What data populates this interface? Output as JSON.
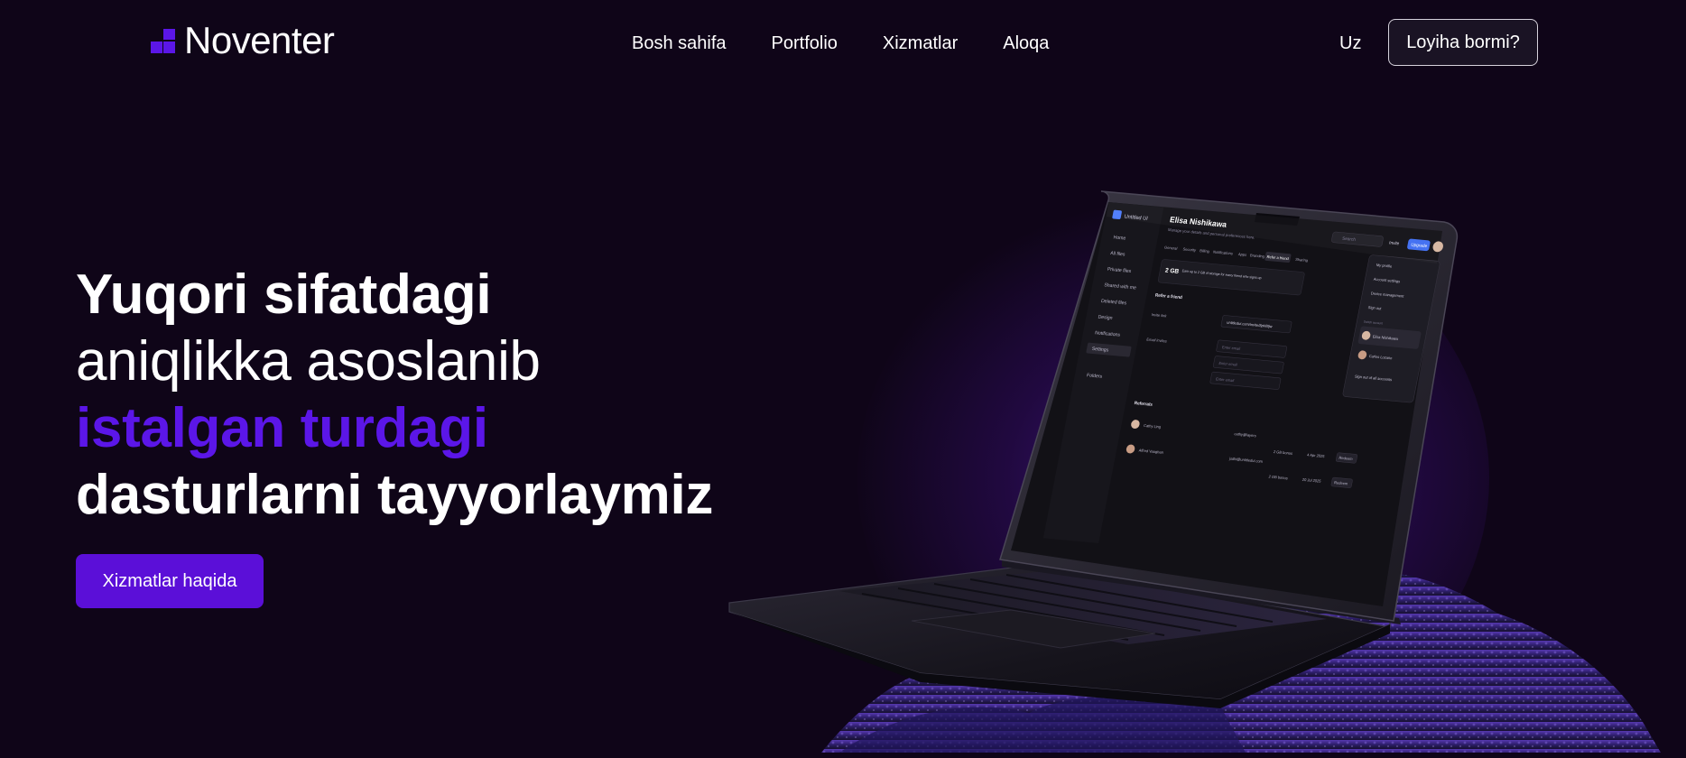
{
  "brand": {
    "name": "Noventer",
    "accent": "#5b16e8"
  },
  "nav": {
    "items": [
      "Bosh sahifa",
      "Portfolio",
      "Xizmatlar",
      "Aloqa"
    ]
  },
  "header": {
    "language": "Uz",
    "cta_label": "Loyiha bormi?"
  },
  "hero": {
    "line1": "Yuqori sifatdagi",
    "line2": "aniqlikka asoslanib",
    "line3": "istalgan turdagi",
    "line4": "dasturlarni tayyorlaymiz",
    "button_label": "Xizmatlar haqida"
  },
  "laptop_screen": {
    "app_name": "Untitled UI",
    "profile_name": "Elisa Nishikawa",
    "subtitle": "Manage your details and personal preferences here.",
    "search_placeholder": "Search",
    "invite_label": "Invite",
    "upgrade_label": "Upgrade",
    "sidebar": [
      "Home",
      "All files",
      "Private files",
      "Shared with me",
      "Deleted files",
      "Design",
      "Notifications",
      "Settings",
      "Folders"
    ],
    "tabs": [
      "General",
      "Security",
      "Billing",
      "Notifications",
      "Apps",
      "Branding",
      "Refer a friend",
      "Sharing"
    ],
    "banner_value": "2 GB",
    "banner_text": "Earn up to 2 GB of storage for every friend who signs up",
    "section_refer": "Refer a friend",
    "invite_link_label": "Invite link",
    "invite_link_value": "untitledui.com/invite/8pHi9jw",
    "email_invites_label": "Email invites",
    "email_placeholder": "Enter email",
    "referrals_label": "Referrals",
    "referrals": [
      {
        "name": "Cathy Ling",
        "handle": "cathy@layers",
        "bonus": "2 GB bonus",
        "date": "4 Apr 2025",
        "action": "Redeem"
      },
      {
        "name": "Alfred Vaughan",
        "handle": "jsdhi@untitledui.com",
        "bonus": "2 GB bonus",
        "date": "20 Jul 2025",
        "action": "Redeem"
      }
    ],
    "menu": [
      "My profile",
      "Account settings",
      "Device management",
      "Sign out"
    ],
    "switch_account_label": "Switch account",
    "accounts": [
      "Elisa Nishikawa",
      "Carlos Lozano"
    ],
    "sign_out_all": "Sign out of all accounts"
  }
}
